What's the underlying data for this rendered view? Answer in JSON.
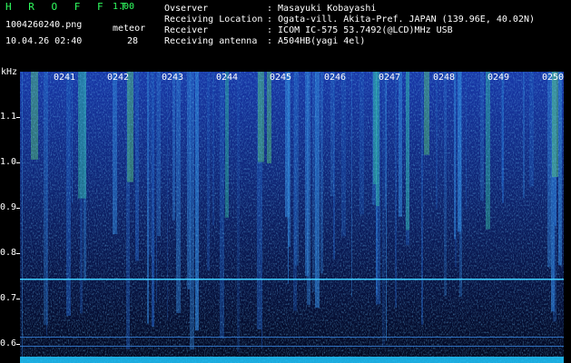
{
  "header": {
    "app_title": "H R O F F T",
    "version": "1.00",
    "filename": "1004260240.png",
    "datetime": "10.04.26 02:40",
    "meteor_label": "meteor",
    "meteor_count": "28"
  },
  "info": [
    {
      "key": "Ovserver",
      "value": ": Masayuki Kobayashi"
    },
    {
      "key": "Receiving Location",
      "value": ": Ogata-vill. Akita-Pref. JAPAN (139.96E, 40.02N)"
    },
    {
      "key": "Receiver",
      "value": ": ICOM IC-575 53.7492(@LCD)MHz USB"
    },
    {
      "key": "Receiving antenna",
      "value": ": A504HB(yagi 4el)"
    }
  ],
  "axis": {
    "unit": "kHz",
    "ticks": [
      "1.1",
      "1.0",
      "0.9",
      "0.8",
      "0.7",
      "0.6"
    ]
  },
  "time_labels": [
    "0241",
    "0242",
    "0243",
    "0244",
    "0245",
    "0246",
    "0247",
    "0248",
    "0249",
    "0250"
  ],
  "colors": {
    "background": "#000000",
    "title_green": "#30ff60",
    "marker_line": "#40d0ff",
    "text": "#ffffff"
  }
}
